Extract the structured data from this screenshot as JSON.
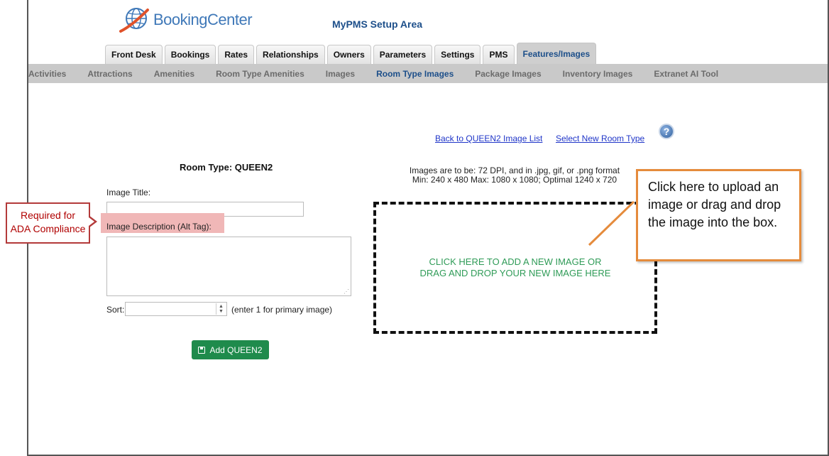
{
  "header": {
    "logo_text": "BookingCenter",
    "app_title": "MyPMS Setup Area"
  },
  "tabs": [
    {
      "label": "Front Desk"
    },
    {
      "label": "Bookings"
    },
    {
      "label": "Rates"
    },
    {
      "label": "Relationships"
    },
    {
      "label": "Owners"
    },
    {
      "label": "Parameters"
    },
    {
      "label": "Settings"
    },
    {
      "label": "PMS"
    },
    {
      "label": "Features/Images",
      "active": true
    }
  ],
  "subnav": [
    {
      "label": "Activities"
    },
    {
      "label": "Attractions"
    },
    {
      "label": "Amenities"
    },
    {
      "label": "Room Type Amenities"
    },
    {
      "label": "Images"
    },
    {
      "label": "Room Type Images",
      "active": true
    },
    {
      "label": "Package Images"
    },
    {
      "label": "Inventory Images"
    },
    {
      "label": "Extranet AI Tool"
    }
  ],
  "links": {
    "back": "Back to QUEEN2 Image List",
    "select": "Select New Room Type"
  },
  "form": {
    "room_type": "Room Type: QUEEN2",
    "image_title_label": "Image Title:",
    "image_title_value": "",
    "image_description_label": "Image Description (Alt Tag):",
    "image_description_value": "",
    "sort_label": "Sort:",
    "sort_value": "",
    "sort_hint": "(enter 1 for primary image)",
    "add_button": "Add QUEEN2"
  },
  "upload": {
    "requirements_line1": "Images are to be: 72 DPI, and in .jpg, gif, or .png format",
    "requirements_line2": "Min: 240 x 480 Max: 1080 x 1080; Optimal 1240 x 720",
    "dropzone_line1": "CLICK HERE TO ADD A NEW IMAGE OR",
    "dropzone_line2": "DRAG AND DROP YOUR NEW IMAGE HERE"
  },
  "annotations": {
    "ada_line1": "Required for",
    "ada_line2": "ADA Compliance",
    "upload_hint": "Click here to upload an image or drag and drop the image into the box."
  },
  "colors": {
    "brand_blue": "#1d4f8a",
    "link_blue": "#1f35c8",
    "add_green": "#1f8b4c",
    "dropzone_green": "#2f9b57",
    "callout_red": "#b33a3a",
    "callout_orange": "#e58b3c",
    "alt_highlight": "#f0b7b7"
  },
  "icons": {
    "logo": "globe-swoosh-icon",
    "help": "question-mark-icon",
    "save": "floppy-disk-icon",
    "spinner": "spinner-arrows-icon"
  }
}
